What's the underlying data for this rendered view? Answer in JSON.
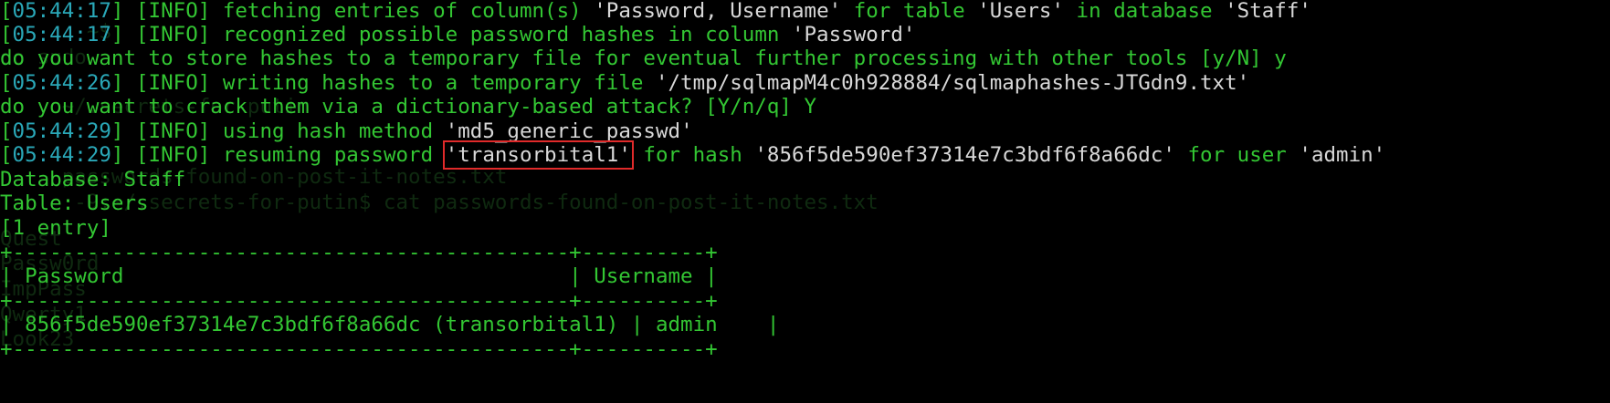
{
  "colors": {
    "background": "#000000",
    "text_green": "#33c633",
    "timestamp_cyan": "#2aa8b8",
    "value_white": "#d8d8d8",
    "highlight_red": "#e02a2a",
    "ghost_text": "#0f2a10"
  },
  "lines": [
    {
      "ts": "05:44:17",
      "level": "[INFO]",
      "pre": " fetching entries of column(s) ",
      "value": "'Password, Username'",
      "mid": " for table ",
      "value2": "'Users'",
      "mid2": " in database ",
      "value3": "'Staff'"
    },
    {
      "ts": "05:44:17",
      "level": "[INFO]",
      "pre": " recognized possible password hashes in column ",
      "value": "'Password'"
    },
    {
      "prompt": "do you want to store hashes to a temporary file for eventual further processing with other tools [y/N] y"
    },
    {
      "ts": "05:44:26",
      "level": "[INFO]",
      "pre": " writing hashes to a temporary file ",
      "value": "'/tmp/sqlmapM4c0h928884/sqlmaphashes-JTGdn9.txt'"
    },
    {
      "prompt": "do you want to crack them via a dictionary-based attack? [Y/n/q] Y"
    },
    {
      "ts": "05:44:29",
      "level": "[INFO]",
      "pre": " using hash method ",
      "value": "'md5_generic_passwd'"
    },
    {
      "ts": "05:44:29",
      "level": "[INFO]",
      "pre": " resuming password ",
      "highlighted": "'transorbital1'",
      "mid": " for hash ",
      "value2": "'856f5de590ef37314e7c3bdf6f8a66dc'",
      "mid2": " for user ",
      "value3": "'admin'"
    },
    {
      "plain": "Database: Staff"
    },
    {
      "plain": "Table: Users"
    },
    {
      "plain": "[1 entry]"
    }
  ],
  "table": {
    "border_top": "+---------------------------------------------+----------+",
    "header": "| Password                                    | Username |",
    "border_mid": "+---------------------------------------------+----------+",
    "row": "| 856f5de590ef37314e7c3bdf6f8a66dc (transorbital1) | admin    |",
    "border_bottom": "+---------------------------------------------+----------+"
  },
  "ghost": {
    "g1": "       ~$",
    "g2": "do sudo",
    "g3": "     ~/.secrets-for-putin",
    "g4": "     passwords-found-on-post-it-notes.txt",
    "g5": "      -9:~/.secrets-for-putin$ cat passwords-found-on-post-it-notes.txt",
    "g6": "Quest",
    "g7": "Passw0rd",
    "g8": "ImpPass",
    "g9": "Qwerty1",
    "g10": "Look23"
  }
}
